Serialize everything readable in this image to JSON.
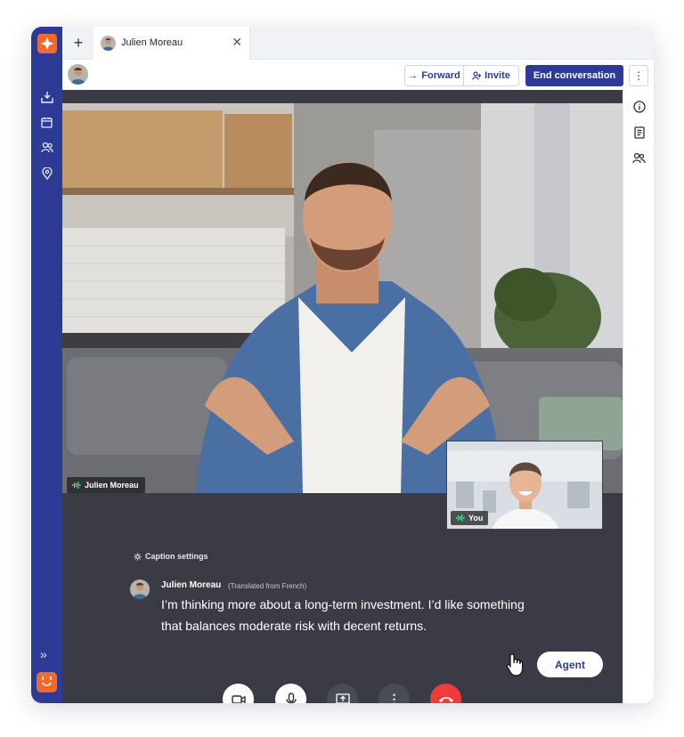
{
  "tabs": [
    {
      "label": "Julien Moreau",
      "close_icon": "close-icon"
    }
  ],
  "toolbar": {
    "forward_label": "Forward",
    "invite_label": "Invite",
    "end_label": "End conversation"
  },
  "video": {
    "remote_name": "Julien Moreau",
    "self_name": "You"
  },
  "captions": {
    "settings_label": "Caption settings",
    "speaker": "Julien Moreau",
    "note": "(Translated from French)",
    "text": "I’m thinking more about a long-term investment. I’d like something that balances moderate risk with decent returns."
  },
  "agent_button": "Agent",
  "colors": {
    "brand": "#2d3a96",
    "accent": "#f26a2b",
    "end_call": "#ef3b3b",
    "stage": "#3a3b44",
    "online": "#2bbf6a"
  },
  "icons": {
    "rail": [
      "inbox-icon",
      "calendar-icon",
      "users-icon",
      "location-icon",
      "expand-icon",
      "bot-icon"
    ],
    "right_rail": [
      "info-icon",
      "notes-icon",
      "participants-icon"
    ],
    "controls": [
      "camera-icon",
      "microphone-icon",
      "screen-share-icon",
      "more-icon",
      "hang-up-icon"
    ]
  }
}
